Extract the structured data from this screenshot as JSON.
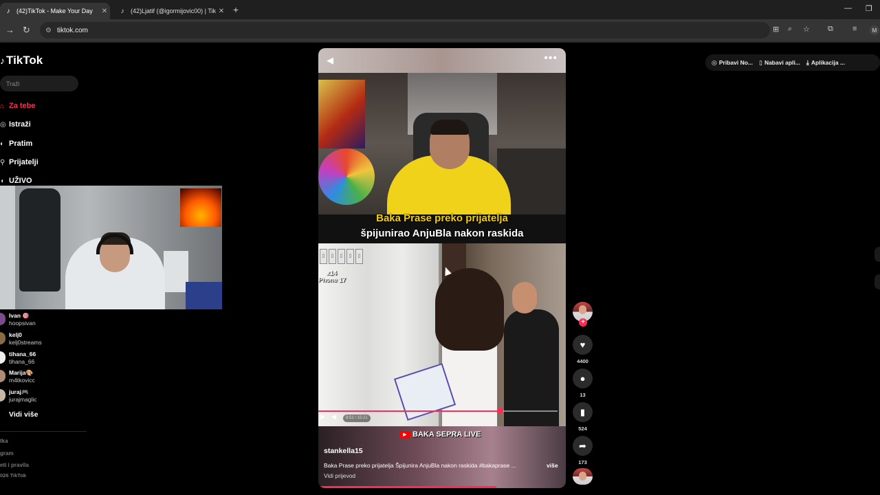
{
  "browser": {
    "tabs": [
      {
        "title": "(42)TikTok - Make Your Day",
        "active": true
      },
      {
        "title": "(42)Ljatif (@igormijovic00) | Tik",
        "active": false
      }
    ],
    "url": "tiktok.com",
    "profile_initial": "M"
  },
  "sidebar": {
    "logo": "TikTok",
    "search_placeholder": "Traži",
    "nav": [
      {
        "label": "Za tebe",
        "icon": "home-icon",
        "active": true
      },
      {
        "label": "Istraži",
        "icon": "compass-icon",
        "active": false
      },
      {
        "label": "Pratim",
        "icon": "following-icon",
        "active": false
      },
      {
        "label": "Prijatelji",
        "icon": "friends-icon",
        "active": false
      },
      {
        "label": "UŽIVO",
        "icon": "live-icon",
        "active": false
      }
    ],
    "following": [
      {
        "name": "Ivan 🎯",
        "handle": "hoopsivan"
      },
      {
        "name": "kelj0",
        "handle": "kelj0streams"
      },
      {
        "name": "tihana_66",
        "handle": "tihana_66"
      },
      {
        "name": "Marija🎨",
        "handle": "m4tkovicc"
      },
      {
        "name": "juraj🎮",
        "handle": "jurajmaglic"
      }
    ],
    "see_more": "Vidi više",
    "footer": [
      "tka",
      "gram",
      "eti i pravila",
      "026 TikTok"
    ]
  },
  "video": {
    "caption_line1": "Baka Prase preko prijatelja",
    "caption_line2": "špijunirao AnjuBla nakon raskida",
    "overlay_x14": "x14",
    "overlay_phone": "Phone 17",
    "time": "8:51 / 15:21",
    "progress": 0.76,
    "live_badge": "BAKA SEPRA LIVE",
    "author": "stankella15",
    "description": "Baka Prase preko prijatelja Špijunira AnjuBla nakon raskida #bakaprase ...",
    "more": "više",
    "translate": "Vidi prijevod",
    "watched": 0.72
  },
  "actions": {
    "likes": "4400",
    "comments": "13",
    "saves": "524",
    "shares": "173"
  },
  "top_right": {
    "items": [
      "Pribavi No...",
      "Nabavi apli...",
      "Aplikacija ..."
    ]
  }
}
